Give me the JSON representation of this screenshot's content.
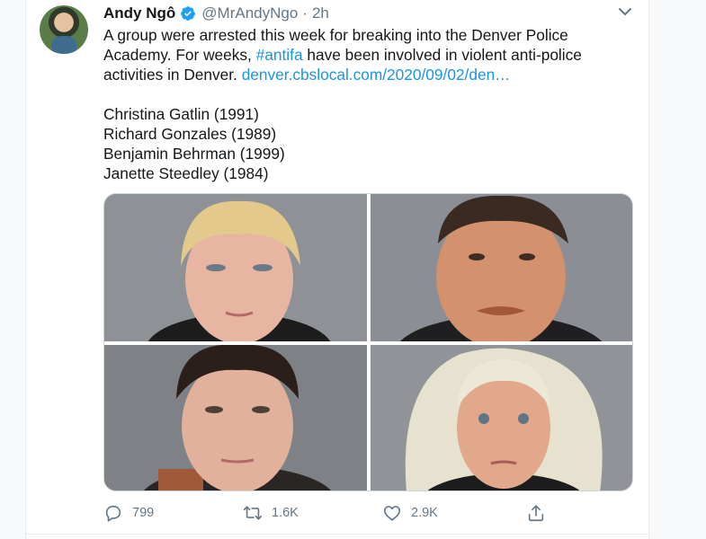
{
  "tweet": {
    "author_name": "Andy Ngô",
    "handle": "@MrAndyNgo",
    "separator": "·",
    "time": "2h",
    "text_line1": "A group were arrested this week for breaking into the Denver Police",
    "text_line2_a": "Academy. For weeks, ",
    "hashtag": "#antifa",
    "text_line2_b": " have been involved in violent anti-police",
    "text_line3_a": "activities in Denver. ",
    "link": "denver.cbslocal.com/2020/09/02/den…",
    "names": [
      "Christina Gatlin (1991)",
      "Richard Gonzales (1989)",
      "Benjamin Behrman (1999)",
      "Janette Steedley (1984)"
    ]
  },
  "actions": {
    "reply_count": "799",
    "retweet_count": "1.6K",
    "like_count": "2.9K"
  },
  "icons": {
    "verified": "verified-badge-icon",
    "caret": "chevron-down-icon",
    "reply": "reply-icon",
    "retweet": "retweet-icon",
    "like": "heart-icon",
    "share": "share-icon"
  },
  "colors": {
    "text": "#14171a",
    "secondary": "#657786",
    "link": "#1b95e0",
    "verified": "#1da1f2",
    "border": "#e6ecf0"
  }
}
